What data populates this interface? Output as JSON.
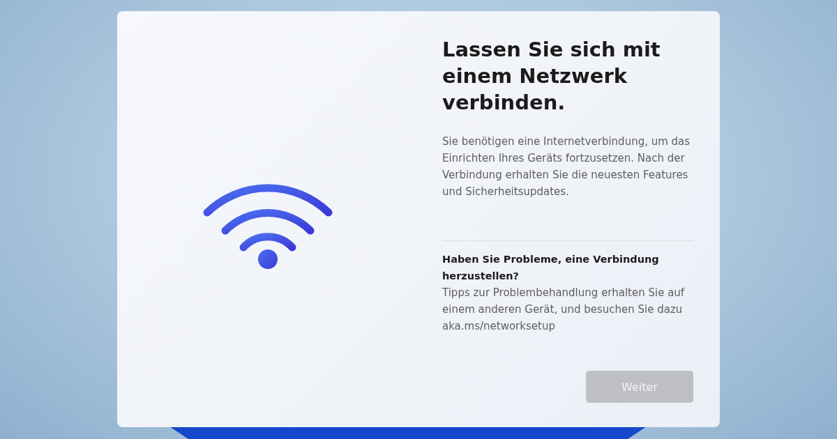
{
  "title": "Lassen Sie sich mit einem Netzwerk verbinden.",
  "description": "Sie benötigen eine Internetverbindung, um das Einrichten Ihres Geräts fortzusetzen. Nach der Verbindung erhalten Sie die neuesten Features und Sicherheitsupdates.",
  "help": {
    "heading": "Haben Sie Probleme, eine Verbindung herzustellen?",
    "text": "Tipps zur Problembehandlung erhalten Sie auf einem anderen Gerät, und besuchen Sie dazu aka.ms/networksetup"
  },
  "next_button": {
    "label": "Weiter",
    "disabled": true
  }
}
